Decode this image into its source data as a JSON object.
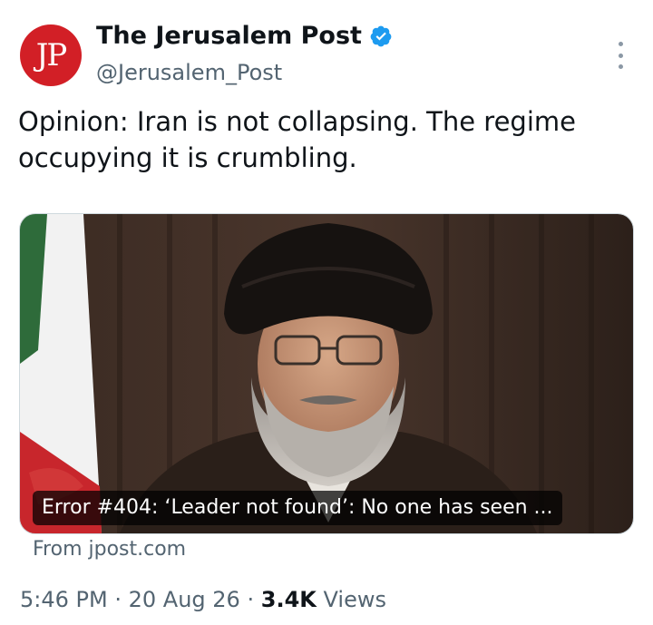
{
  "account": {
    "display_name": "The Jerusalem Post",
    "handle": "@Jerusalem_Post",
    "avatar_text": "JP",
    "avatar_color": "#d21f26",
    "verified": true,
    "verified_icon": "verified-badge-icon",
    "verified_color": "#1d9bf0"
  },
  "tweet": {
    "text": "Opinion: Iran is not collapsing. The regime occupying it is crumbling."
  },
  "card": {
    "image_subject": "portrait-of-cleric-with-iranian-flag",
    "headline": "Error #404: ‘Leader not found’: No one has seen ...",
    "source": "From jpost.com"
  },
  "meta": {
    "time": "5:46 PM",
    "separator": "·",
    "date": "20 Aug 26",
    "views_count": "3.4K",
    "views_label": "Views"
  },
  "colors": {
    "text_primary": "#0f1419",
    "text_secondary": "#536471"
  }
}
